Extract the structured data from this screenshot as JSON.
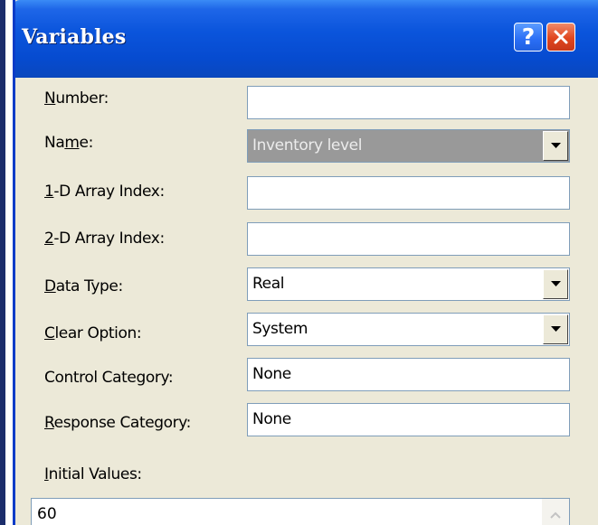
{
  "window": {
    "title": "Variables",
    "help_button": "?",
    "close_button": "close"
  },
  "fields": {
    "number": {
      "label_prefix": "",
      "label_accel": "N",
      "label_rest": "umber:",
      "value": ""
    },
    "name": {
      "label_prefix": "Na",
      "label_accel": "m",
      "label_rest": "e:",
      "value": "Inventory level"
    },
    "array1d": {
      "label_prefix": "",
      "label_accel": "1",
      "label_rest": "-D Array Index:",
      "value": ""
    },
    "array2d": {
      "label_prefix": "",
      "label_accel": "2",
      "label_rest": "-D Array Index:",
      "value": ""
    },
    "data_type": {
      "label_prefix": "",
      "label_accel": "D",
      "label_rest": "ata Type:",
      "value": "Real"
    },
    "clear_option": {
      "label_prefix": "",
      "label_accel": "C",
      "label_rest": "lear Option:",
      "value": "System"
    },
    "control_category": {
      "label": "Control Category:",
      "value": "None"
    },
    "response_category": {
      "label_prefix": "",
      "label_accel": "R",
      "label_rest": "esponse Category:",
      "value": "None"
    }
  },
  "initial_values": {
    "label_accel": "I",
    "label_rest": "nitial Values:",
    "items": [
      "60"
    ]
  },
  "colors": {
    "titlebar": "#0b55dc",
    "dialog_bg": "#ece9d8",
    "disabled_field": "#999999"
  }
}
